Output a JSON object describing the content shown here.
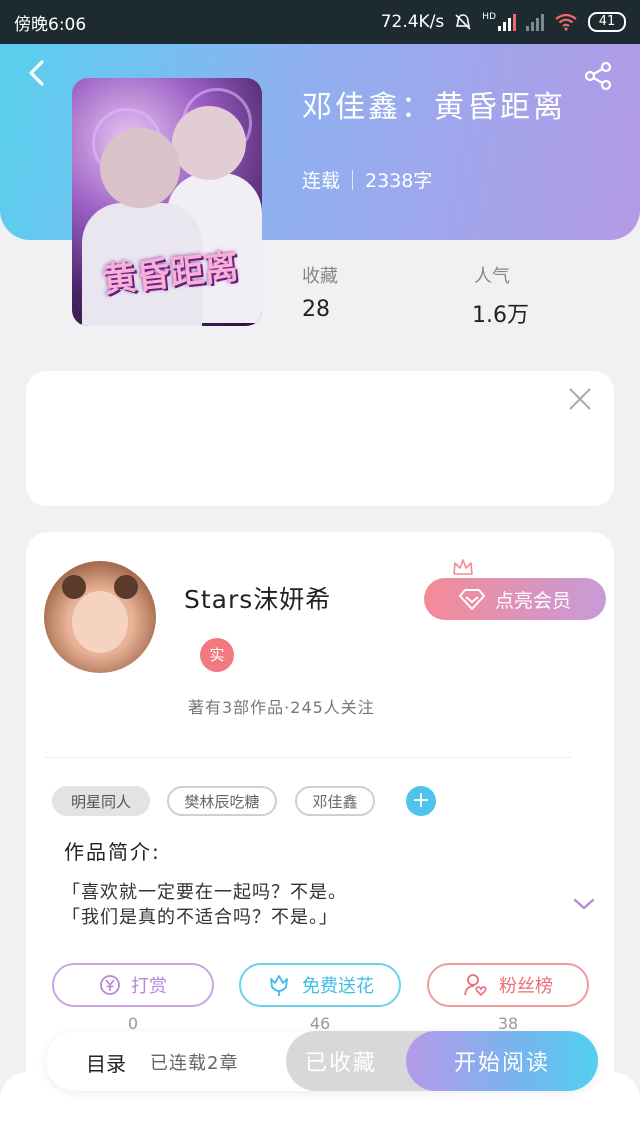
{
  "status_bar": {
    "time": "傍晚6:06",
    "network_speed": "72.4K/s",
    "hd_label": "HD",
    "battery": "41"
  },
  "book": {
    "cover_title": "黄昏距离",
    "title": "邓佳鑫：黄昏距离",
    "status": "连载",
    "word_count": "2338字",
    "favorites_label": "收藏",
    "favorites_value": "28",
    "popularity_label": "人气",
    "popularity_value": "1.6万"
  },
  "author": {
    "name": "Stars沫妍希",
    "verified_badge": "实",
    "vip_button": "点亮会员",
    "stats": "著有3部作品·245人关注"
  },
  "tags": [
    {
      "label": "明星同人"
    },
    {
      "label": "樊林辰吃糖"
    },
    {
      "label": "邓佳鑫"
    }
  ],
  "tag_add": "+",
  "intro": {
    "label": "作品简介:",
    "line1": "「喜欢就一定要在一起吗？不是。",
    "line2": "「我们是真的不适合吗？不是。」"
  },
  "actions": [
    {
      "label": "打赏",
      "count": "0",
      "color": "#b48ad8"
    },
    {
      "label": "免费送花",
      "count": "46",
      "color": "#3fbde6"
    },
    {
      "label": "粉丝榜",
      "count": "38",
      "color": "#ec6f77"
    }
  ],
  "bottom": {
    "toc_label": "目录",
    "toc_status": "已连载2章",
    "favorite_button": "已收藏",
    "read_button": "开始阅读"
  },
  "icons": {
    "back": "back-arrow-icon",
    "share": "share-icon",
    "close": "close-icon",
    "expand": "chevron-down-icon",
    "vip": "diamond-icon",
    "crown": "crown-icon"
  },
  "colors": {
    "header_gradient_start": "#58d0ee",
    "header_gradient_end": "#b39ae6",
    "vip_start": "#f58a97",
    "vip_end": "#c69bd9",
    "accent_blue": "#4fc3ec"
  }
}
